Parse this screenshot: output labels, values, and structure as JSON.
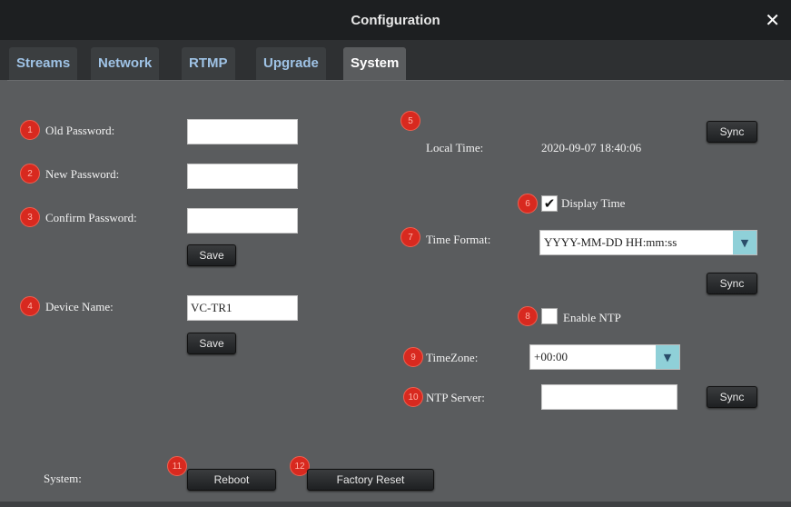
{
  "window": {
    "title": "Configuration",
    "close_label": "✕"
  },
  "tabs": [
    {
      "label": "Streams"
    },
    {
      "label": "Network"
    },
    {
      "label": "RTMP"
    },
    {
      "label": "Upgrade"
    },
    {
      "label": "System",
      "active": true
    }
  ],
  "markers": [
    "1",
    "2",
    "3",
    "4",
    "5",
    "6",
    "7",
    "8",
    "9",
    "10",
    "11",
    "12"
  ],
  "password": {
    "old_label": "Old Password:",
    "new_label": "New Password:",
    "confirm_label": "Confirm Password:",
    "old_value": "",
    "new_value": "",
    "confirm_value": "",
    "save_label": "Save"
  },
  "device": {
    "name_label": "Device Name:",
    "name_value": "VC-TR1",
    "save_label": "Save"
  },
  "time": {
    "local_label": "Local Time:",
    "local_value": "2020-09-07 18:40:06",
    "sync_label": "Sync",
    "display_time_label": "Display Time",
    "display_time_checked": true,
    "format_label": "Time Format:",
    "format_value": "YYYY-MM-DD HH:mm:ss",
    "format_sync_label": "Sync"
  },
  "ntp": {
    "enable_label": "Enable NTP",
    "enable_checked": false,
    "timezone_label": "TimeZone:",
    "timezone_value": "+00:00",
    "server_label": "NTP Server:",
    "server_value": "",
    "sync_label": "Sync"
  },
  "system": {
    "label": "System:",
    "reboot_label": "Reboot",
    "factory_reset_label": "Factory Reset"
  },
  "colors": {
    "marker": "#d8291f",
    "title_bg": "#1d1f21",
    "panel_bg": "#5a5c5e",
    "tab_text": "#9fc3e6"
  }
}
